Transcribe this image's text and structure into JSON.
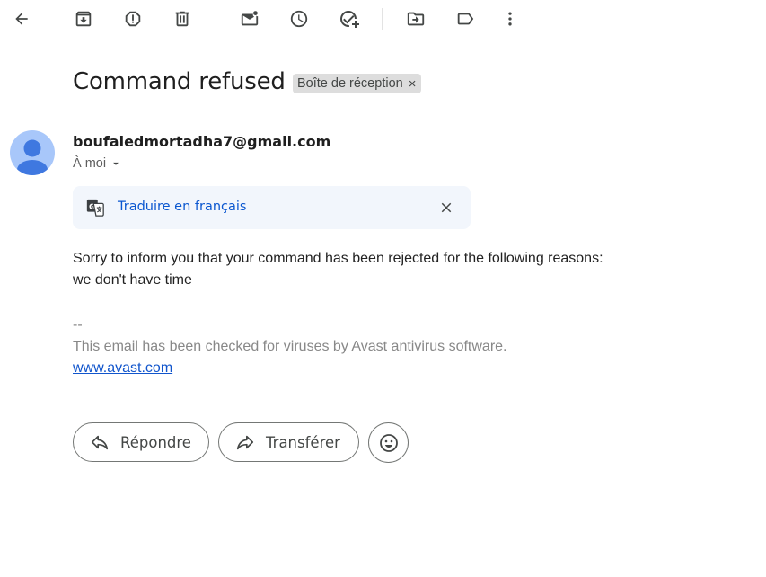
{
  "toolbar": {
    "icons": [
      "back-arrow-icon",
      "archive-icon",
      "report-spam-icon",
      "delete-icon",
      "mark-unread-icon",
      "snooze-icon",
      "add-to-tasks-icon",
      "move-to-icon",
      "label-icon",
      "more-options-icon"
    ]
  },
  "message": {
    "subject": "Command refused",
    "label": "Boîte de réception",
    "label_remove": "×",
    "sender_email": "boufaiedmortadha7@gmail.com",
    "recipient": "À moi",
    "avatar_color": "#a8c7fa"
  },
  "translate": {
    "link": "Traduire en français",
    "icons": [
      "translate-icon",
      "close-icon"
    ]
  },
  "body": {
    "line1": "Sorry to inform you that your command has been rejected for the following reasons:",
    "line2": "we don't have time",
    "signature_sep": "--",
    "signature_text": "This email has been checked for viruses by Avast antivirus software.",
    "signature_link": "www.avast.com"
  },
  "actions": {
    "reply": "Répondre",
    "forward": "Transférer",
    "emoji_icon": "emoji-icon"
  },
  "colors": {
    "link": "#0b57d0",
    "signature_link": "#1155cc",
    "translate_bg": "#f2f6fc",
    "chip_bg": "#dddddd"
  }
}
